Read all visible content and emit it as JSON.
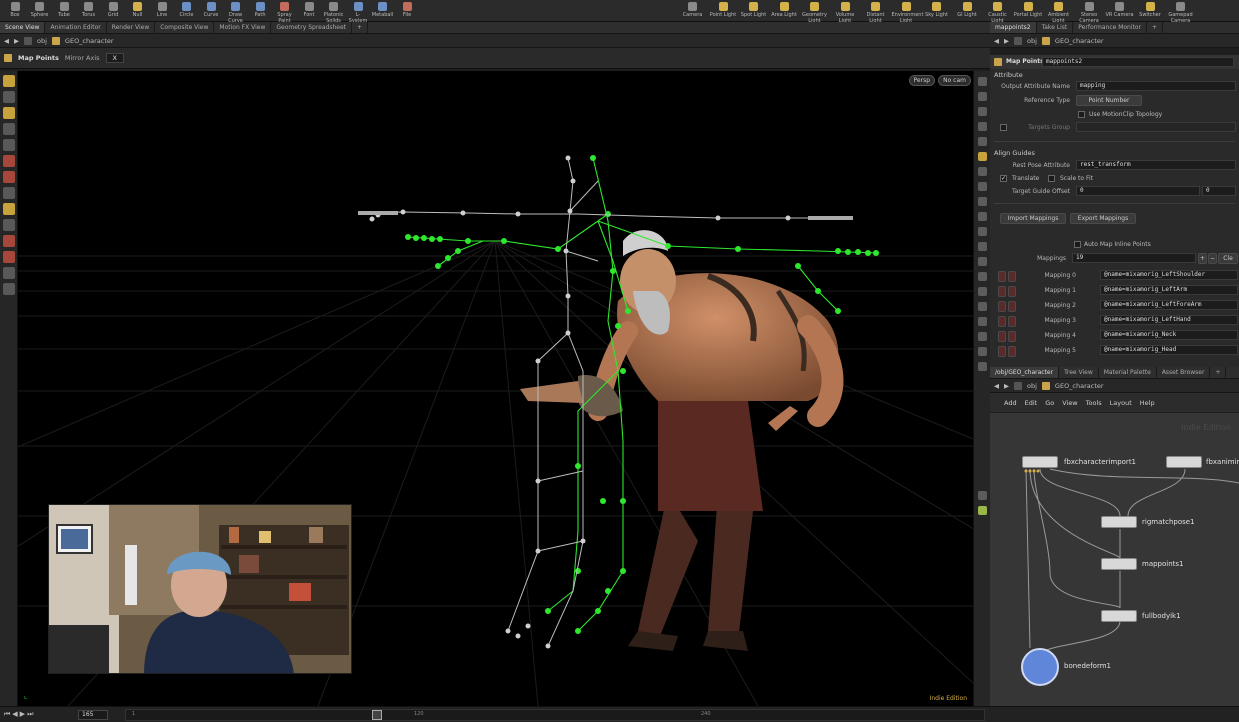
{
  "shelf": {
    "left_tools": [
      "Box",
      "Sphere",
      "Tube",
      "Torus",
      "Grid",
      "Null",
      "Line",
      "Circle",
      "Curve",
      "Draw Curve",
      "Path",
      "Spray Paint",
      "Font",
      "Platonic Solids",
      "L-System",
      "Metaball",
      "File"
    ],
    "right_tools": [
      "Camera",
      "Point Light",
      "Spot Light",
      "Area Light",
      "Geometry Light",
      "Volume Light",
      "Distant Light",
      "Environment Light",
      "Sky Light",
      "GI Light",
      "Caustic Light",
      "Portal Light",
      "Ambient Light",
      "Stereo Camera",
      "VR Camera",
      "Switcher",
      "Gamepad Camera"
    ]
  },
  "left_pane": {
    "tabs": [
      "Scene View",
      "Animation Editor",
      "Render View",
      "Composite View",
      "Motion FX View",
      "Geometry Spreadsheet"
    ],
    "path": [
      "obj",
      "GEO_character"
    ],
    "tool_label": "Map Points",
    "mirror_axis_label": "Mirror Axis",
    "mirror_axis_value": "X",
    "viewport": {
      "persp_label": "Persp",
      "cam_label": "No cam",
      "watermark": "Indie Edition"
    }
  },
  "right_pane": {
    "tabs": [
      "mappoints2",
      "Take List",
      "Performance Monitor"
    ],
    "path": [
      "obj",
      "GEO_character"
    ],
    "node_type": "Map Points",
    "node_name": "mappoints2",
    "attribute_section": "Attribute",
    "output_attr_label": "Output Attribute Name",
    "output_attr_value": "mapping",
    "ref_type_label": "Reference Type",
    "ref_type_value": "Point Number",
    "use_motionclip_label": "Use MotionClip Topology",
    "targets_group_label": "Targets Group",
    "align_section": "Align Guides",
    "rest_pose_label": "Rest Pose Attribute",
    "rest_pose_value": "rest_transform",
    "translate_label": "Translate",
    "scale_label": "Scale to Fit",
    "offset_label": "Target Guide Offset",
    "offset_x": "0",
    "offset_y": "0",
    "import_btn": "Import Mappings",
    "export_btn": "Export Mappings",
    "auto_map_label": "Auto Map Inline Points",
    "mappings_label": "Mappings",
    "mappings_count": "19",
    "clear_btn": "Cle",
    "mappings": [
      {
        "label": "Mapping 0",
        "value": "@name=mixamorig_LeftShoulder"
      },
      {
        "label": "Mapping 1",
        "value": "@name=mixamorig_LeftArm"
      },
      {
        "label": "Mapping 2",
        "value": "@name=mixamorig_LeftForeArm"
      },
      {
        "label": "Mapping 3",
        "value": "@name=mixamorig_LeftHand"
      },
      {
        "label": "Mapping 4",
        "value": "@name=mixamorig_Neck"
      },
      {
        "label": "Mapping 5",
        "value": "@name=mixamorig_Head"
      }
    ]
  },
  "network_pane": {
    "tabs": [
      "/obj/GEO_character",
      "Tree View",
      "Material Palette",
      "Asset Browser"
    ],
    "path": [
      "obj",
      "GEO_character"
    ],
    "menu": [
      "Add",
      "Edit",
      "Go",
      "View",
      "Tools",
      "Layout",
      "Help"
    ],
    "watermark": "Indie Edition",
    "nodes": [
      "fbxcharacterimport1",
      "fbxanimimport",
      "rigmatchpose1",
      "mappoints1",
      "fullbodyik1",
      "bonedeform1"
    ]
  },
  "timeline": {
    "frame": "165",
    "ticks": [
      "1",
      "120",
      "240"
    ]
  },
  "colors": {
    "accent": "#c9a44a",
    "skeleton_green": "#2ee82e",
    "node_blue": "#5f86d8"
  }
}
